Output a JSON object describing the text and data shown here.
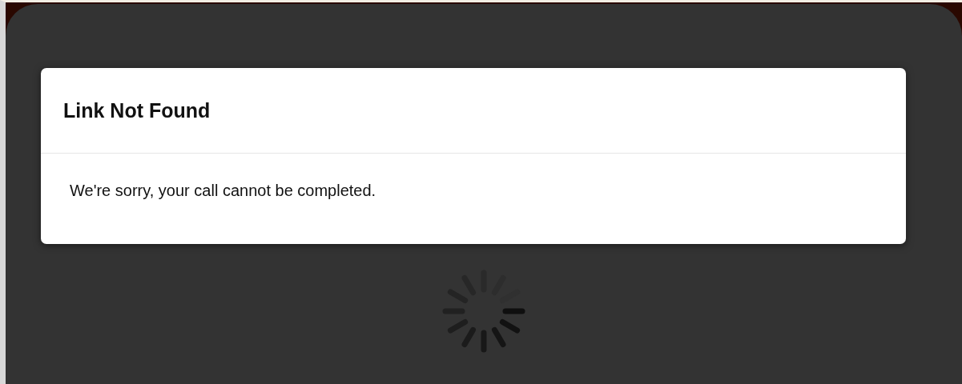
{
  "dialog": {
    "title": "Link Not Found",
    "message": "We're sorry, your call cannot be completed."
  }
}
